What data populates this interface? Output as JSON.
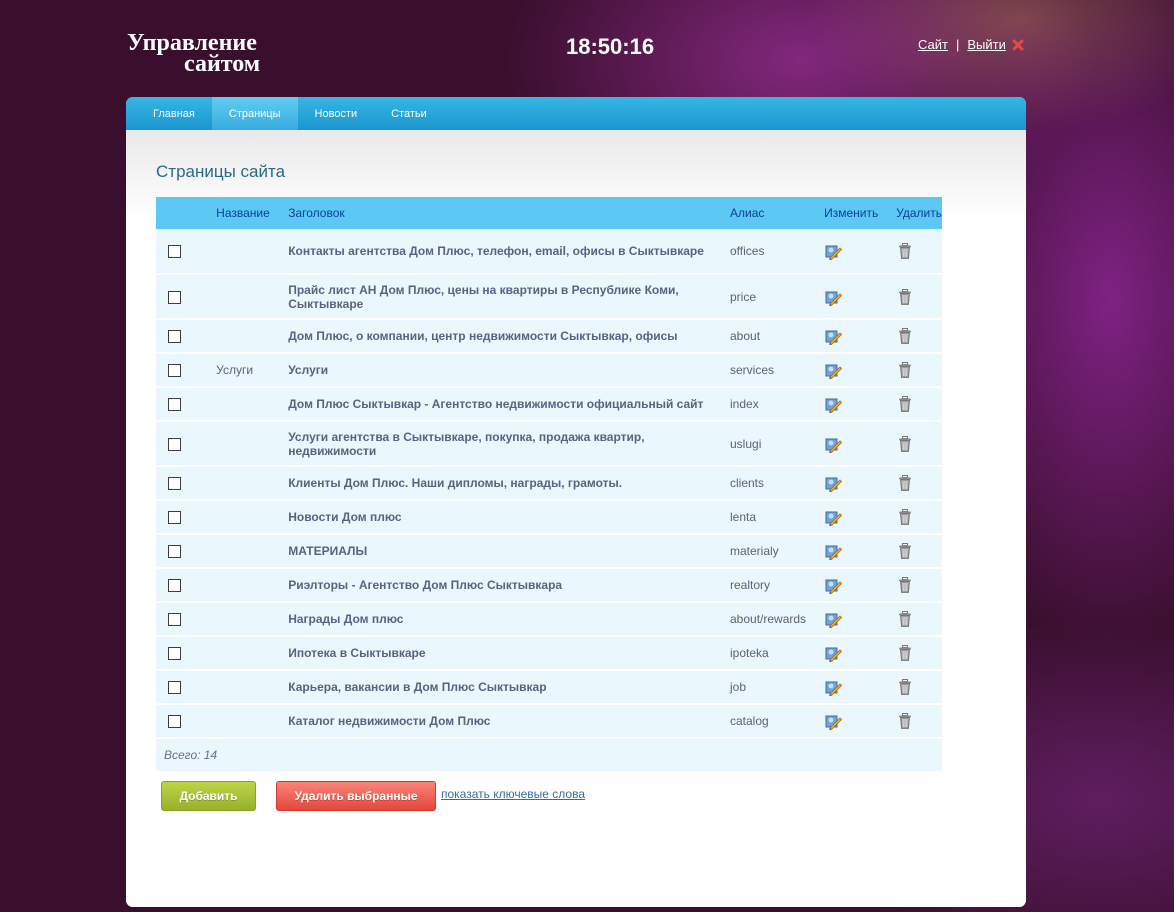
{
  "header": {
    "logo_line1": "Управление",
    "logo_line2": "сайтом",
    "clock": "18:50:16",
    "site_link": "Сайт",
    "separator": "|",
    "logout_link": "Выйти"
  },
  "tabs": [
    {
      "label": "Главная"
    },
    {
      "label": "Страницы"
    },
    {
      "label": "Новости"
    },
    {
      "label": "Статьи"
    }
  ],
  "active_tab": "Страницы",
  "page_title": "Страницы сайта",
  "table": {
    "columns": {
      "name": "Название",
      "title": "Заголовок",
      "alias": "Алиас",
      "edit": "Изменить",
      "delete": "Удалить"
    },
    "rows": [
      {
        "name": "",
        "title": "Контакты агентства Дом Плюс, телефон, email, офисы в Сыктывкаре",
        "alias": "offices"
      },
      {
        "name": "",
        "title": "Прайс лист АН Дом Плюс, цены на квартиры в Республике Коми, Сыктывкаре",
        "alias": "price"
      },
      {
        "name": "",
        "title": "Дом Плюс, о компании, центр недвижимости Сыктывкар, офисы",
        "alias": "about"
      },
      {
        "name": "Услуги",
        "title": "Услуги",
        "alias": "services"
      },
      {
        "name": "",
        "title": "Дом Плюс Сыктывкар - Агентство недвижимости официальный сайт",
        "alias": "index"
      },
      {
        "name": "",
        "title": "Услуги агентства в Сыктывкаре, покупка, продажа квартир, недвижимости",
        "alias": "uslugi"
      },
      {
        "name": "",
        "title": "Клиенты Дом Плюс. Наши дипломы, награды, грамоты.",
        "alias": "clients"
      },
      {
        "name": "",
        "title": "Новости Дом плюс",
        "alias": "lenta"
      },
      {
        "name": "",
        "title": "МАТЕРИАЛЫ",
        "alias": "materialy"
      },
      {
        "name": "",
        "title": "Риэлторы - Агентство Дом Плюс Сыктывкара",
        "alias": "realtory"
      },
      {
        "name": "",
        "title": "Награды Дом плюс",
        "alias": "about/rewards"
      },
      {
        "name": "",
        "title": "Ипотека в Сыктывкаре",
        "alias": "ipoteka"
      },
      {
        "name": "",
        "title": "Карьера, вакансии в Дом Плюс Сыктывкар",
        "alias": "job"
      },
      {
        "name": "",
        "title": "Каталог недвижимости Дом Плюс",
        "alias": "catalog"
      }
    ],
    "total": "Всего: 14"
  },
  "buttons": {
    "add": "Добавить",
    "delete_selected": "Удалить выбранные",
    "keywords_link": "показать ключевые слова"
  },
  "icons": {
    "edit": "edit-pencil-icon",
    "delete": "trash-icon",
    "logout": "close-x-icon"
  },
  "colors": {
    "tab_bar": "#1b95cf",
    "table_header": "#5bc9f3",
    "add_button": "#95b22a",
    "delete_button": "#e5463b",
    "background": "#3a0f2e"
  }
}
